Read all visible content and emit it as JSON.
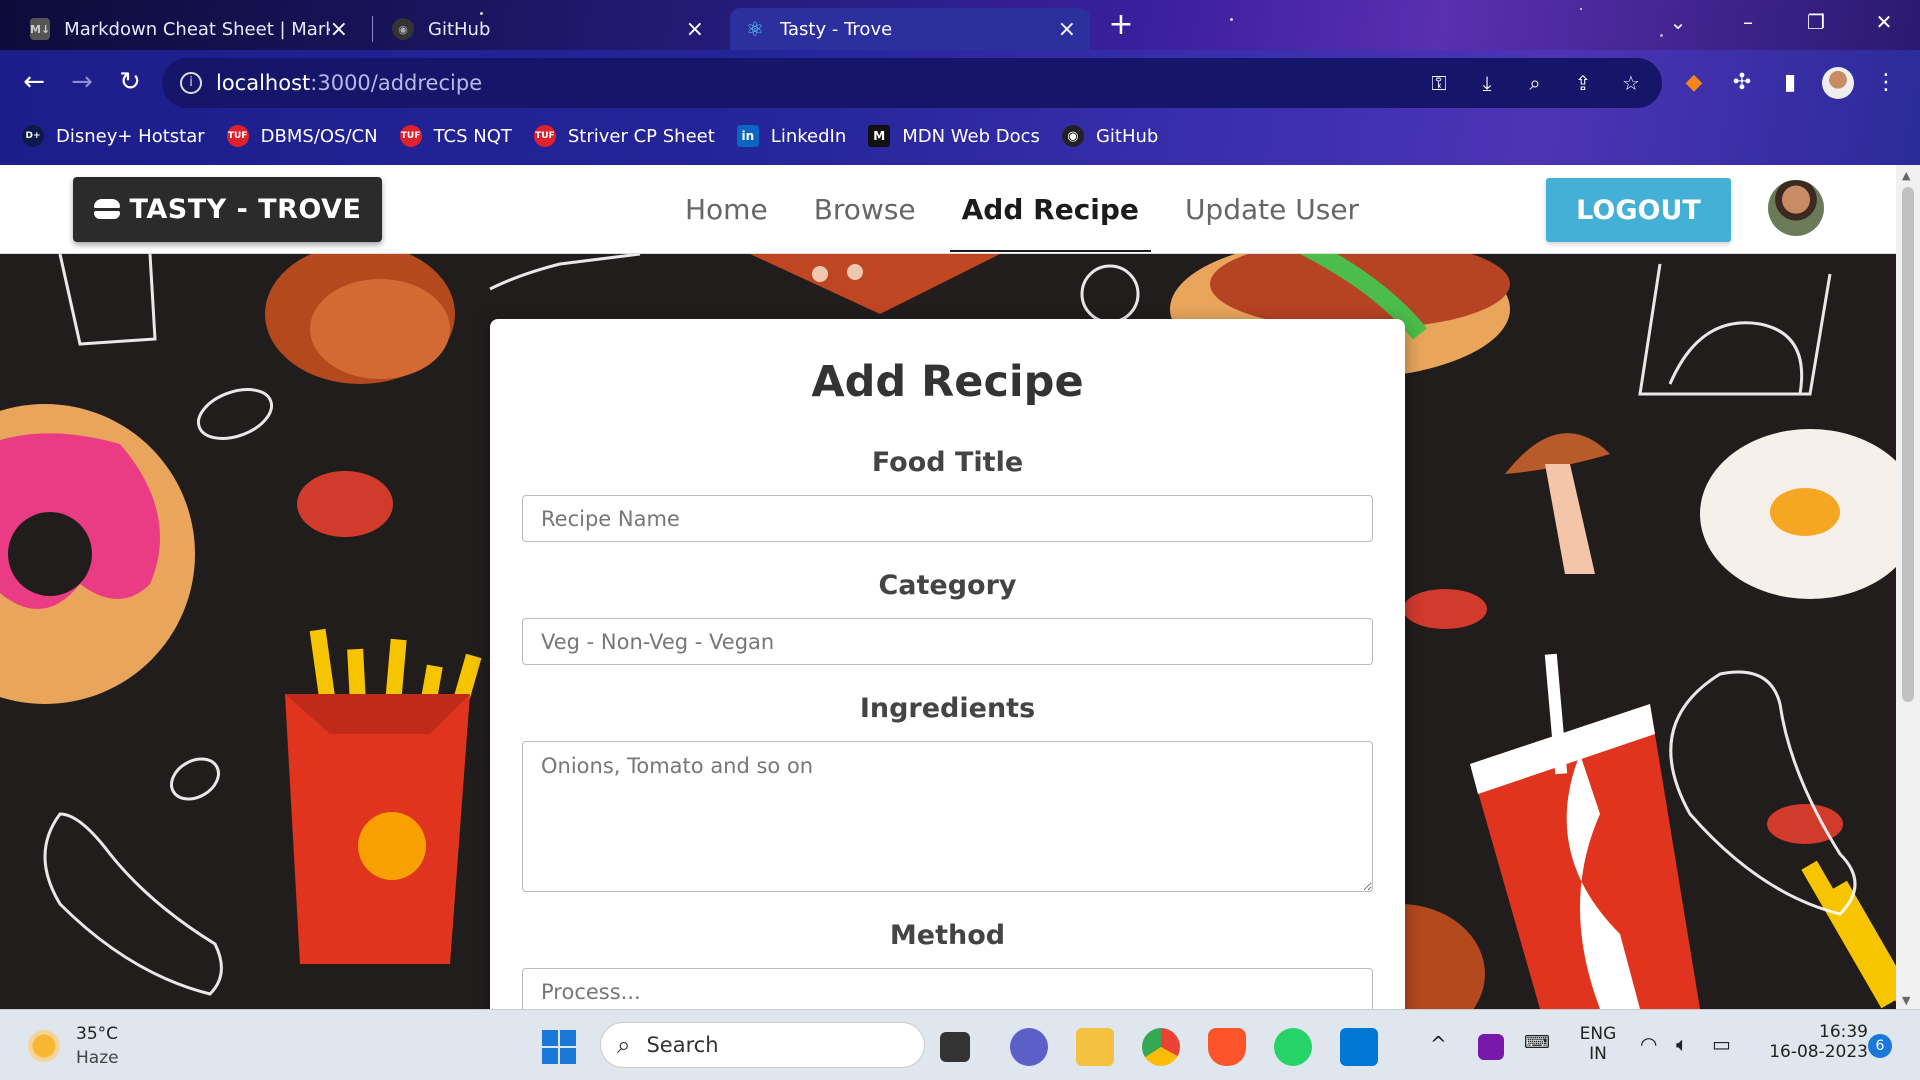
{
  "browser": {
    "tabs": [
      {
        "title": "Markdown Cheat Sheet | Markdo",
        "favicon": "markdown-icon"
      },
      {
        "title": "GitHub",
        "favicon": "github-icon"
      },
      {
        "title": "Tasty - Trove",
        "favicon": "react-icon"
      }
    ],
    "url_host": "localhost",
    "url_rest": ":3000/addrecipe",
    "bookmarks": [
      {
        "label": "Disney+ Hotstar",
        "icon": "hotstar-icon",
        "color": "#0c1a4a",
        "abbr": "D+"
      },
      {
        "label": "DBMS/OS/CN",
        "icon": "tuf-icon",
        "color": "#e0202a",
        "abbr": "TUF"
      },
      {
        "label": "TCS NQT",
        "icon": "tuf-icon",
        "color": "#e0202a",
        "abbr": "TUF"
      },
      {
        "label": "Striver CP Sheet",
        "icon": "tuf-icon",
        "color": "#e0202a",
        "abbr": "TUF"
      },
      {
        "label": "LinkedIn",
        "icon": "linkedin-icon",
        "color": "#0a66c2",
        "abbr": "in"
      },
      {
        "label": "MDN Web Docs",
        "icon": "mdn-icon",
        "color": "#111111",
        "abbr": "M"
      },
      {
        "label": "GitHub",
        "icon": "github-icon",
        "color": "#222222",
        "abbr": "◉"
      }
    ]
  },
  "app": {
    "brand": "TASTY - TROVE",
    "nav": [
      {
        "label": "Home",
        "active": false
      },
      {
        "label": "Browse",
        "active": false
      },
      {
        "label": "Add Recipe",
        "active": true
      },
      {
        "label": "Update User",
        "active": false
      }
    ],
    "logout": "LOGOUT",
    "accent": "#45b0d6"
  },
  "form": {
    "title": "Add Recipe",
    "food_title_label": "Food Title",
    "food_title_placeholder": "Recipe Name",
    "category_label": "Category",
    "category_placeholder": "Veg - Non-Veg - Vegan",
    "ingredients_label": "Ingredients",
    "ingredients_placeholder": "Onions, Tomato and so on",
    "method_label": "Method",
    "method_placeholder": "Process..."
  },
  "taskbar": {
    "weather_temp": "35°C",
    "weather_desc": "Haze",
    "search_label": "Search",
    "lang_top": "ENG",
    "lang_bottom": "IN",
    "time": "16:39",
    "date": "16-08-2023",
    "notifications": "6"
  }
}
